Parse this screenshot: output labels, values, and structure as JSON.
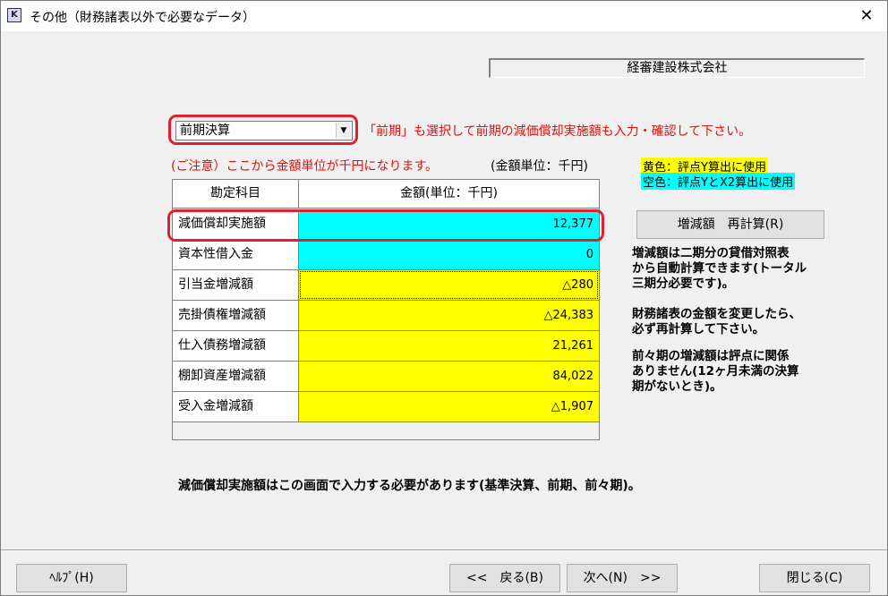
{
  "window": {
    "title": "その他（財務諸表以外で必要なデータ）",
    "close_glyph": "✕",
    "icon_glyph": "K"
  },
  "company": "経審建設株式会社",
  "period_select": {
    "value": "前期決算",
    "arrow": "▼"
  },
  "notes": {
    "red_instruction": "「前期」も選択して前期の減価償却実施額も入力・確認して下さい。",
    "caution": "(ご注意）ここから金額単位が千円になります。",
    "unit": "(金額単位：千円)",
    "legend_yellow": "黄色：評点Y算出に使用",
    "legend_cyan": "空色：評点YとX2算出に使用"
  },
  "table": {
    "headers": [
      "勘定科目",
      "金額(単位：千円)"
    ],
    "rows": [
      {
        "name": "減価償却実施額",
        "value": "12,377",
        "color": "#00ffff"
      },
      {
        "name": "資本性借入金",
        "value": "0",
        "color": "#00ffff"
      },
      {
        "name": "引当金増減額",
        "value": "△280",
        "color": "#ffff00"
      },
      {
        "name": "売掛債権増減額",
        "value": "△24,383",
        "color": "#ffff00"
      },
      {
        "name": "仕入債務増減額",
        "value": "21,261",
        "color": "#ffff00"
      },
      {
        "name": "棚卸資産増減額",
        "value": "84,022",
        "color": "#ffff00"
      },
      {
        "name": "受入金増減額",
        "value": "△1,907",
        "color": "#ffff00"
      }
    ]
  },
  "recalc_button": "増減額　再計算(R)",
  "info": {
    "p1": [
      "増減額は二期分の貸借対照表",
      "から自動計算できます(トータル",
      "三期分必要です)。"
    ],
    "p2": [
      "財務諸表の金額を変更したら、",
      "必ず再計算して下さい。"
    ],
    "p3": [
      "前々期の増減額は評点に関係",
      "ありません(12ヶ月未満の決算",
      "期がないとき)。"
    ]
  },
  "bottom_note": "減価償却実施額はこの画面で入力する必要があります(基準決算、前期、前々期)。",
  "buttons": {
    "help": "ﾍﾙﾌﾟ(H)",
    "back": "<<　戻る(B)",
    "next": "次へ(N)　>>",
    "close": "閉じる(C)"
  },
  "colors": {
    "accent_red": "#e0202a",
    "cyan": "#00ffff",
    "yellow": "#ffff00"
  }
}
